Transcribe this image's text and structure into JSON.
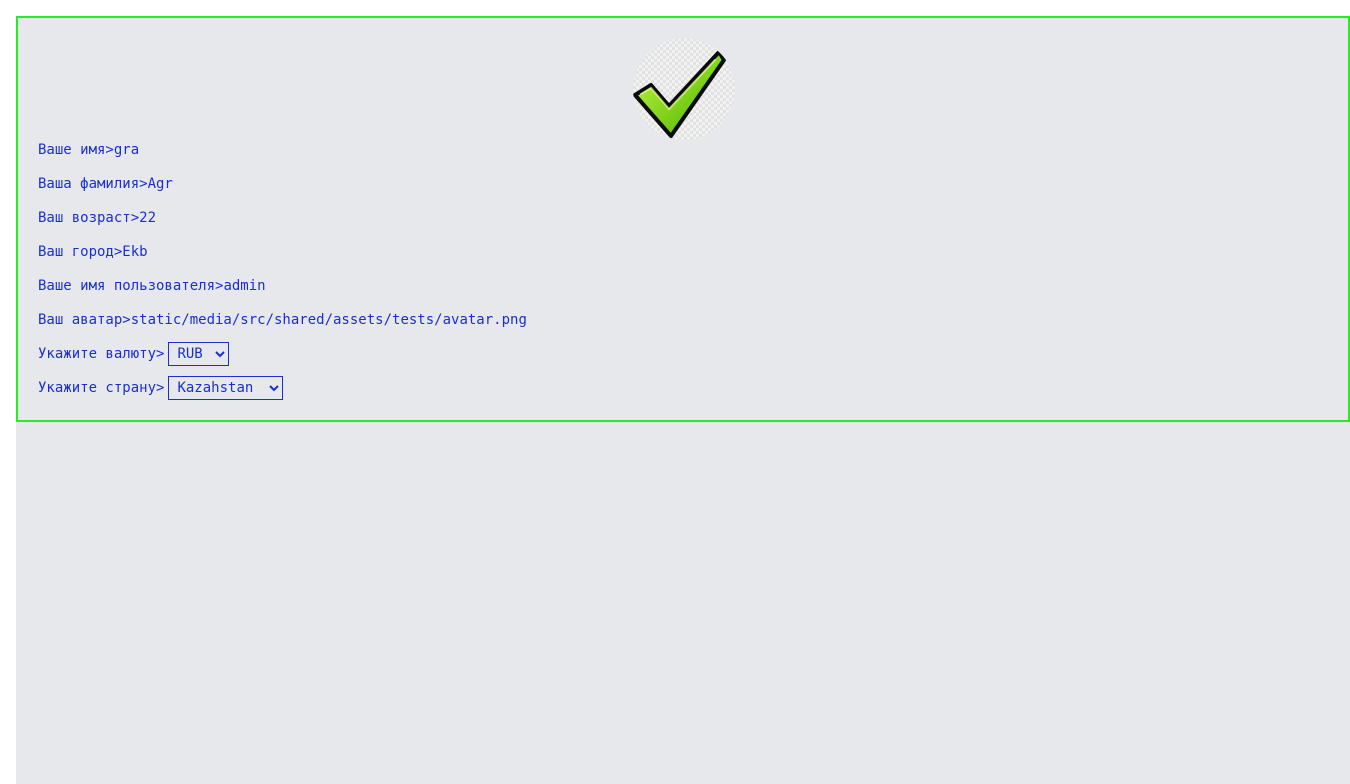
{
  "profile": {
    "avatar_icon": "checkmark-icon",
    "colors": {
      "text": "#1a2fd0",
      "border": "#22ee22",
      "background": "#e7e8eb"
    },
    "fields": [
      {
        "label": "Ваше имя>",
        "value": "gra"
      },
      {
        "label": "Ваша фамилия>",
        "value": "Agr"
      },
      {
        "label": "Ваш возраст>",
        "value": "22"
      },
      {
        "label": "Ваш город>",
        "value": "Ekb"
      },
      {
        "label": "Ваше имя пользователя>",
        "value": "admin"
      },
      {
        "label": "Ваш аватар>",
        "value": "static/media/src/shared/assets/tests/avatar.png"
      }
    ],
    "currency": {
      "label": "Укажите валюту>",
      "selected": "RUB"
    },
    "country": {
      "label": "Укажите страну>",
      "selected": "Kazahstan"
    }
  }
}
